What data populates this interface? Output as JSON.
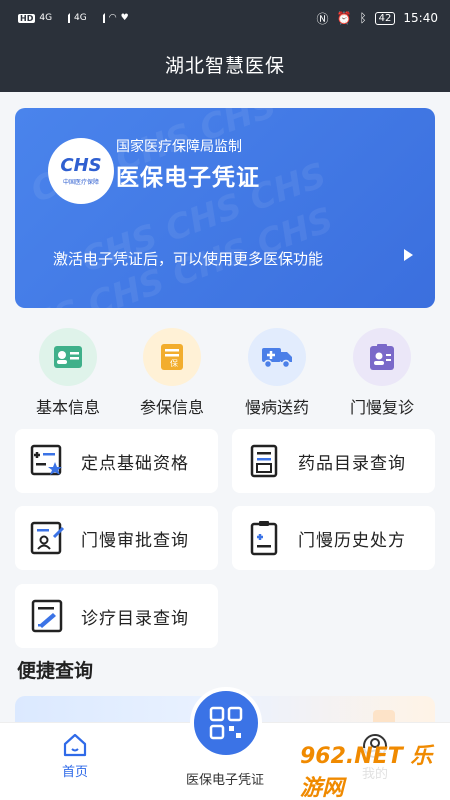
{
  "status_bar": {
    "left_badges": [
      "HD",
      "4G",
      "4G"
    ],
    "time": "15:40",
    "battery": "42"
  },
  "header": {
    "title": "湖北智慧医保"
  },
  "banner": {
    "logo_text": "CHS",
    "logo_subtext": "中国医疗保障",
    "supervisor": "国家医疗保障局监制",
    "title": "医保电子凭证",
    "description": "激活电子凭证后，可以使用更多医保功能"
  },
  "quick_actions": [
    {
      "label": "基本信息",
      "icon": "id-card-icon",
      "bg": "#dff3ea",
      "color": "#3fb08a"
    },
    {
      "label": "参保信息",
      "icon": "insurance-doc-icon",
      "bg": "#fff1d6",
      "color": "#f2ad2d"
    },
    {
      "label": "慢病送药",
      "icon": "delivery-truck-icon",
      "bg": "#e2ecfd",
      "color": "#4b7fe8"
    },
    {
      "label": "门慢复诊",
      "icon": "doctor-card-icon",
      "bg": "#ebe7f8",
      "color": "#7a69c9"
    }
  ],
  "tiles": [
    {
      "label": "定点基础资格",
      "icon": "qualification-icon"
    },
    {
      "label": "药品目录查询",
      "icon": "drug-catalog-icon"
    },
    {
      "label": "门慢审批查询",
      "icon": "approval-icon"
    },
    {
      "label": "门慢历史处方",
      "icon": "prescription-icon"
    },
    {
      "label": "诊疗目录查询",
      "icon": "treatment-catalog-icon"
    }
  ],
  "section": {
    "title": "便捷查询"
  },
  "bottom_nav": {
    "home_label": "首页",
    "center_label": "医保电子凭证",
    "mine_label": "我的"
  },
  "watermark": {
    "text": "962.NET 乐游网"
  },
  "colors": {
    "accent": "#3b73e6",
    "header_bg": "#2b313a"
  }
}
